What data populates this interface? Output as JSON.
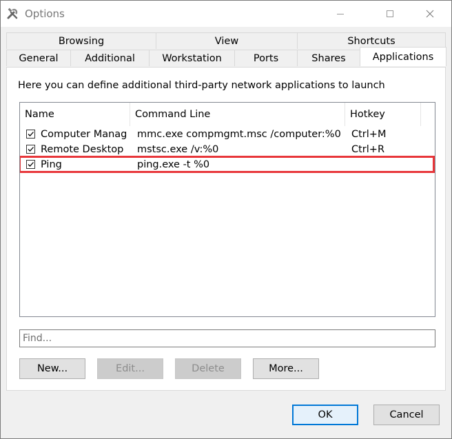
{
  "window": {
    "title": "Options",
    "app_icon": "tools-icon"
  },
  "tabs": {
    "row1": [
      {
        "label": "Browsing"
      },
      {
        "label": "View"
      },
      {
        "label": "Shortcuts"
      }
    ],
    "row2": [
      {
        "label": "General"
      },
      {
        "label": "Additional"
      },
      {
        "label": "Workstation"
      },
      {
        "label": "Ports"
      },
      {
        "label": "Shares"
      },
      {
        "label": "Applications",
        "active": true
      }
    ]
  },
  "panel": {
    "description": "Here you can define additional third-party network applications to launch",
    "columns": {
      "name": "Name",
      "command": "Command Line",
      "hotkey": "Hotkey"
    },
    "rows": [
      {
        "checked": true,
        "name": "Computer Manag...",
        "command": "mmc.exe compmgmt.msc /computer:%0",
        "hotkey": "Ctrl+M"
      },
      {
        "checked": true,
        "name": "Remote Desktop",
        "command": "mstsc.exe /v:%0",
        "hotkey": "Ctrl+R"
      },
      {
        "checked": true,
        "name": "Ping",
        "command": "ping.exe -t %0",
        "hotkey": "",
        "highlighted": true
      }
    ],
    "find": {
      "placeholder": "Find...",
      "value": ""
    },
    "buttons": {
      "new": "New...",
      "edit": "Edit...",
      "delete": "Delete",
      "more": "More..."
    }
  },
  "footer": {
    "ok": "OK",
    "cancel": "Cancel"
  },
  "colors": {
    "highlight": "#e8363a",
    "accent": "#0078d7"
  }
}
